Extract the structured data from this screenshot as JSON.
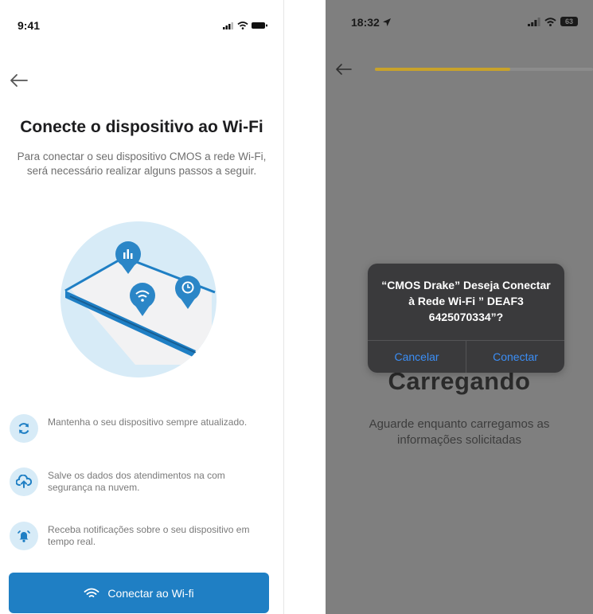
{
  "left_screen": {
    "status_time": "9:41",
    "icons": [
      "signal-icon",
      "wifi-icon",
      "battery-icon",
      "back-arrow-icon"
    ],
    "title": "Conecte o dispositivo ao Wi-Fi",
    "description": "Para conectar o seu dispositivo CMOS a rede Wi-Fi, será necessário realizar alguns passos a seguir.",
    "features": [
      {
        "icon": "refresh-icon",
        "text": "Mantenha o seu dispositivo sempre atualizado."
      },
      {
        "icon": "cloud-upload-icon",
        "text": "Salve os dados dos atendimentos na com segurança na nuvem."
      },
      {
        "icon": "alarm-bell-icon",
        "text": "Receba notificações sobre o seu dispositivo em tempo real."
      }
    ],
    "button_label": "Conectar ao Wi-fi",
    "colors": {
      "accent": "#1f7fc4",
      "illustration_bg": "#d7ebf7"
    }
  },
  "right_screen": {
    "status_time": "18:32",
    "battery_text": "63",
    "progress": 0.62,
    "loading_title": "Carregando",
    "loading_desc": "Aguarde enquanto carregamos as informações solicitadas",
    "alert": {
      "message": "“CMOS Drake” Deseja Conectar à Rede Wi-Fi ” DEAF3 6425070334”?",
      "cancel_label": "Cancelar",
      "confirm_label": "Conectar"
    },
    "colors": {
      "overlay": "#7f7f7f",
      "progress": "#c8a22a",
      "alert_bg": "#3a3a3c",
      "alert_button": "#3b8ef6"
    }
  }
}
